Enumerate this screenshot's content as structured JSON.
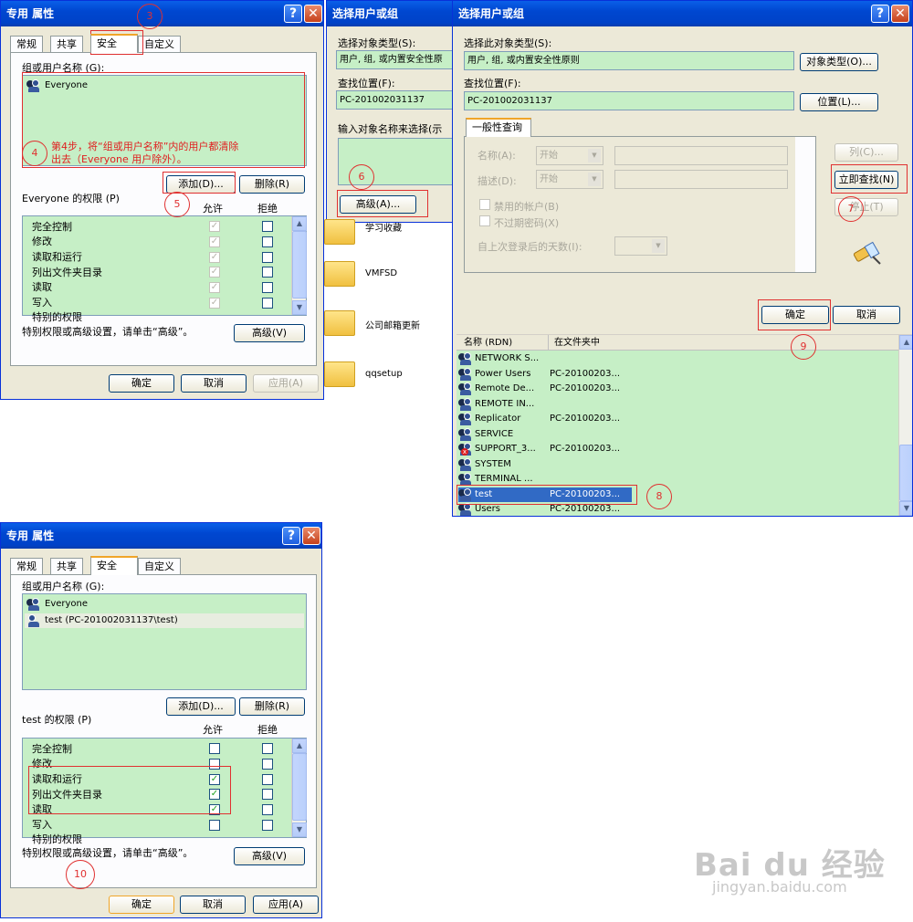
{
  "props_top": {
    "title": "专用 属性",
    "tabs": [
      "常规",
      "共享",
      "安全",
      "自定义"
    ],
    "group_label": "组或用户名称 (G):",
    "users": [
      "Everyone"
    ],
    "add": "添加(D)...",
    "remove": "删除(R)",
    "perm_label": "Everyone 的权限 (P)",
    "allow": "允许",
    "deny": "拒绝",
    "perms": [
      "完全控制",
      "修改",
      "读取和运行",
      "列出文件夹目录",
      "读取",
      "写入",
      "特别的权限"
    ],
    "special_note": "特别权限或高级设置，请单击“高级”。",
    "advanced": "高级(V)",
    "ok": "确定",
    "cancel": "取消",
    "apply": "应用(A)"
  },
  "annot": {
    "c3": "3",
    "c4": "4",
    "c5": "5",
    "c6": "6",
    "c7": "7",
    "c8": "8",
    "c9": "9",
    "c10": "10",
    "step4_line1": "第4步，将“组或用户名称”内的用户都清除",
    "step4_line2": "出去（Everyone 用户除外）。"
  },
  "select_small": {
    "title": "选择用户或组",
    "type_label": "选择对象类型(S):",
    "type_value": "用户, 组, 或内置安全性原",
    "loc_label": "查找位置(F):",
    "loc_value": "PC-201002031137",
    "enter_label": "输入对象名称来选择(示",
    "advanced": "高级(A)..."
  },
  "folders": [
    "学习收藏",
    "VMFSD",
    "公司邮箱更新",
    "qqsetup"
  ],
  "select_large": {
    "title": "选择用户或组",
    "type_label": "选择此对象类型(S):",
    "type_value": "用户, 组, 或内置安全性原则",
    "type_button": "对象类型(O)...",
    "loc_label": "查找位置(F):",
    "loc_value": "PC-201002031137",
    "loc_button": "位置(L)...",
    "query_tab": "一般性查询",
    "name_label": "名称(A):",
    "desc_label": "描述(D):",
    "starts": "开始",
    "disabled_accounts": "禁用的帐户(B)",
    "no_expire": "不过期密码(X)",
    "days_label": "自上次登录后的天数(I):",
    "col_btn": "列(C)...",
    "find_now": "立即查找(N)",
    "stop": "停止(T)",
    "ok": "确定",
    "cancel": "取消",
    "col_name": "名称 (RDN)",
    "col_folder": "在文件夹中",
    "results": [
      {
        "name": "NETWORK S...",
        "folder": ""
      },
      {
        "name": "Power Users",
        "folder": "PC-20100203..."
      },
      {
        "name": "Remote De...",
        "folder": "PC-20100203..."
      },
      {
        "name": "REMOTE IN...",
        "folder": ""
      },
      {
        "name": "Replicator",
        "folder": "PC-20100203..."
      },
      {
        "name": "SERVICE",
        "folder": ""
      },
      {
        "name": "SUPPORT_3...",
        "folder": "PC-20100203..."
      },
      {
        "name": "SYSTEM",
        "folder": ""
      },
      {
        "name": "TERMINAL ...",
        "folder": ""
      },
      {
        "name": "test",
        "folder": "PC-20100203..."
      },
      {
        "name": "Users",
        "folder": "PC-20100203..."
      }
    ]
  },
  "props_bottom": {
    "title": "专用 属性",
    "tabs": [
      "常规",
      "共享",
      "安全",
      "自定义"
    ],
    "group_label": "组或用户名称 (G):",
    "users": [
      "Everyone",
      "test (PC-201002031137\\test)"
    ],
    "add": "添加(D)...",
    "remove": "删除(R)",
    "perm_label": "test 的权限 (P)",
    "allow": "允许",
    "deny": "拒绝",
    "perms": [
      "完全控制",
      "修改",
      "读取和运行",
      "列出文件夹目录",
      "读取",
      "写入",
      "特别的权限"
    ],
    "special_note": "特别权限或高级设置，请单击“高级”。",
    "advanced": "高级(V)",
    "ok": "确定",
    "cancel": "取消",
    "apply": "应用(A)"
  },
  "watermark": {
    "logo": "Bai du 经验",
    "url": "jingyan.baidu.com"
  }
}
